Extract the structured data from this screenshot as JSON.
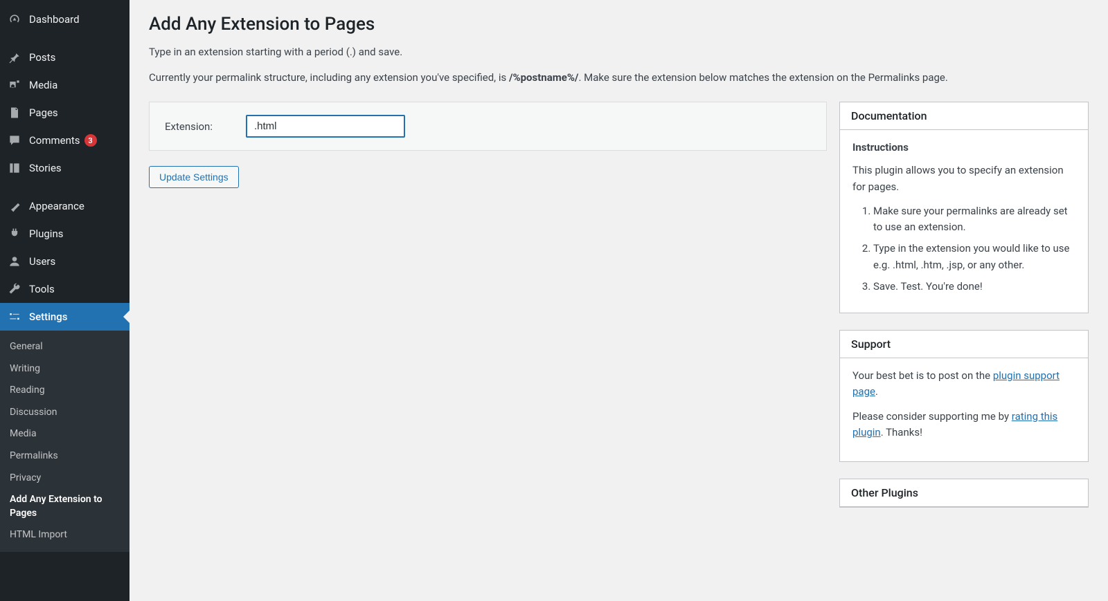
{
  "sidebar": {
    "menu": [
      {
        "id": "dashboard",
        "label": "Dashboard"
      },
      {
        "id": "posts",
        "label": "Posts"
      },
      {
        "id": "media",
        "label": "Media"
      },
      {
        "id": "pages",
        "label": "Pages"
      },
      {
        "id": "comments",
        "label": "Comments",
        "badge": "3"
      },
      {
        "id": "stories",
        "label": "Stories"
      },
      {
        "id": "appearance",
        "label": "Appearance"
      },
      {
        "id": "plugins",
        "label": "Plugins"
      },
      {
        "id": "users",
        "label": "Users"
      },
      {
        "id": "tools",
        "label": "Tools"
      },
      {
        "id": "settings",
        "label": "Settings"
      }
    ],
    "submenu": [
      "General",
      "Writing",
      "Reading",
      "Discussion",
      "Media",
      "Permalinks",
      "Privacy",
      "Add Any Extension to Pages",
      "HTML Import"
    ],
    "active_submenu_index": 7
  },
  "page": {
    "title": "Add Any Extension to Pages",
    "description": "Type in an extension starting with a period (.) and save.",
    "permalink_prefix": "Currently your permalink structure, including any extension you've specified, is ",
    "permalink_value": "/%postname%/",
    "permalink_suffix": ". Make sure the extension below matches the extension on the Permalinks page.",
    "form": {
      "label": "Extension:",
      "value": ".html",
      "button": "Update Settings"
    }
  },
  "docs": {
    "header": "Documentation",
    "instructions_header": "Instructions",
    "intro": "This plugin allows you to specify an extension for pages.",
    "steps": [
      "Make sure your permalinks are already set to use an extension.",
      "Type in the extension you would like to use e.g. .html, .htm, .jsp, or any other.",
      "Save. Test. You're done!"
    ]
  },
  "support": {
    "header": "Support",
    "line1_prefix": "Your best bet is to post on the ",
    "line1_link": "plugin support page",
    "line1_suffix": ".",
    "line2_prefix": "Please consider supporting me by ",
    "line2_link": "rating this plugin",
    "line2_suffix": ". Thanks!"
  },
  "other_plugins": {
    "header": "Other Plugins"
  }
}
